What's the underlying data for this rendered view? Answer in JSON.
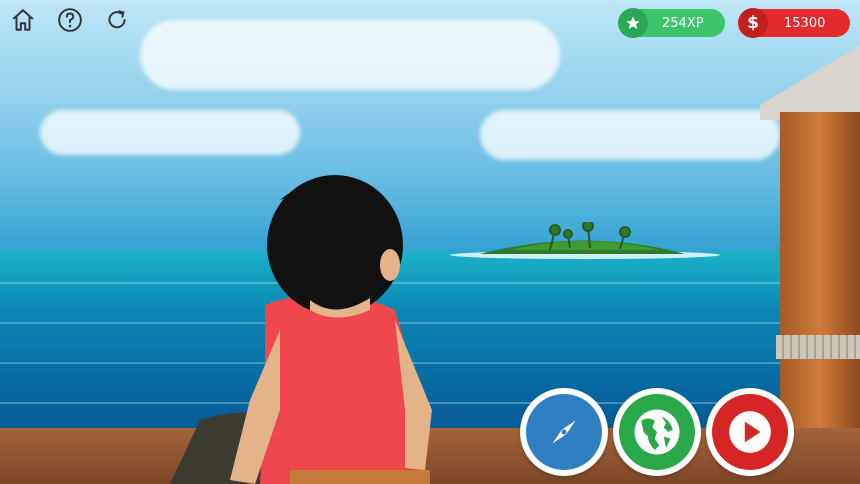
{
  "toolbar": {
    "home_icon": "home-icon",
    "help_icon": "help-icon",
    "refresh_icon": "refresh-icon"
  },
  "stats": {
    "xp_label": "254XP",
    "xp_color": "#3dc56b",
    "xp_icon": "star-icon",
    "money_label": "15300",
    "money_color": "#e32b2b",
    "money_icon": "dollar-icon"
  },
  "actions": {
    "compass_color": "#2f7fc2",
    "globe_color": "#2aa84a",
    "play_color": "#d62525"
  }
}
